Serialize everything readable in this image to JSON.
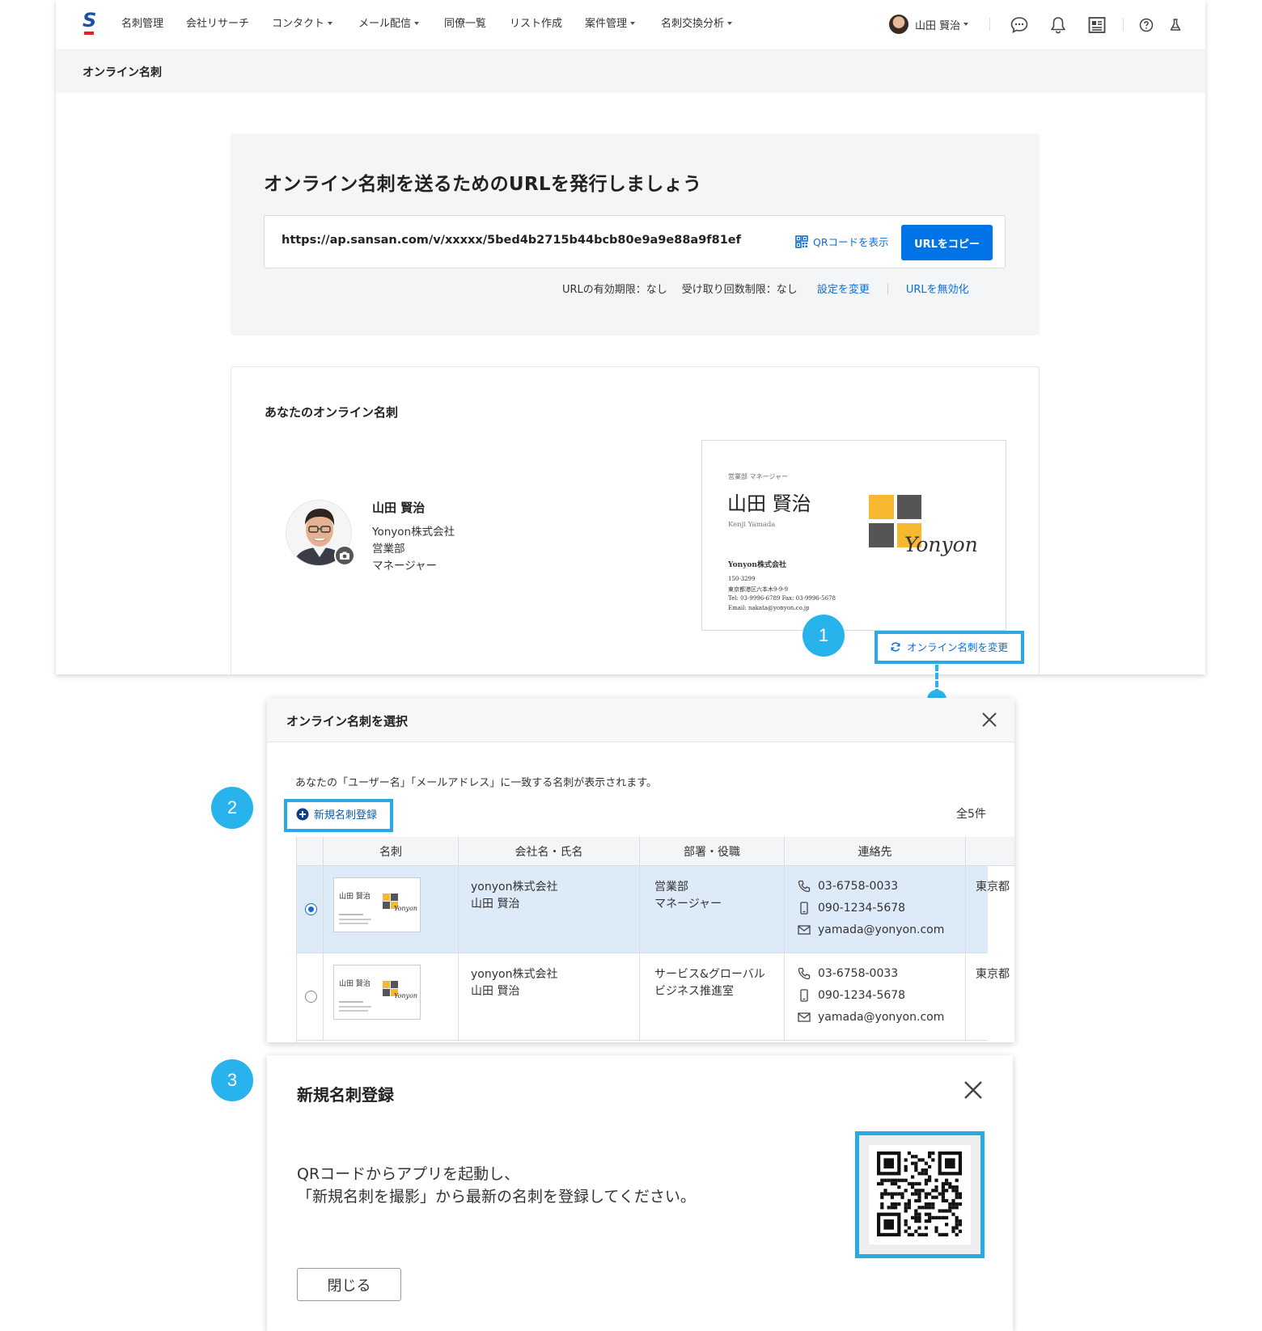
{
  "nav": {
    "items": [
      "名刺管理",
      "会社リサーチ",
      "コンタクト",
      "メール配信",
      "同僚一覧",
      "リスト作成",
      "案件管理",
      "名刺交換分析"
    ],
    "user_name": "山田 賢治"
  },
  "subheader": {
    "title": "オンライン名刺"
  },
  "url_panel": {
    "heading": "オンライン名刺を送るためのURLを発行しましょう",
    "url": "https://ap.sansan.com/v/xxxxx/5bed4b2715b44bcb80e9a9e88a9f81ef",
    "qr_label": "QRコードを表示",
    "copy_label": "URLをコピー",
    "expiry": "URLの有効期限：なし",
    "limit": "受け取り回数制限：なし",
    "change_settings": "設定を変更",
    "disable_url": "URLを無効化"
  },
  "card_panel": {
    "title": "あなたのオンライン名刺",
    "profile": {
      "name": "山田 賢治",
      "company": "Yonyon株式会社",
      "department": "営業部",
      "position": "マネージャー"
    },
    "business_card": {
      "dept_title": "営業部 マネージャー",
      "name": "山田 賢治",
      "romaji": "Kenji Yamada",
      "company": "Yonyon株式会社",
      "postal": "150-3299",
      "address": "東京都港区六本木9-9-9",
      "tel_fax": "Tel: 03-9996-6789   Fax: 03-9996-5678",
      "email": "Email: nakata@yonyon.co.jp",
      "logo_text": "Yonyon"
    },
    "change_link": "オンライン名刺を変更"
  },
  "steps": [
    "1",
    "2",
    "3"
  ],
  "select_modal": {
    "title": "オンライン名刺を選択",
    "description": "あなたの「ユーザー名」「メールアドレス」に一致する名刺が表示されます。",
    "new_button": "新規名刺登録",
    "total": "全5件",
    "columns": [
      "名刺",
      "会社名・氏名",
      "部署・役職",
      "連絡先"
    ],
    "rows": [
      {
        "company": "yonyon株式会社",
        "name": "山田 賢治",
        "dept": "営業部",
        "title": "マネージャー",
        "phone": "03-6758-0033",
        "mobile": "090-1234-5678",
        "email": "yamada@yonyon.com",
        "address": "東京都",
        "selected": true,
        "thumb": {
          "name": "山田 賢治",
          "logo": "Yonyon"
        }
      },
      {
        "company": "yonyon株式会社",
        "name": "山田 賢治",
        "dept": "サービス&グローバル",
        "title": "ビジネス推進室",
        "phone": "03-6758-0033",
        "mobile": "090-1234-5678",
        "email": "yamada@yonyon.com",
        "address": "東京都",
        "selected": false,
        "thumb": {
          "name": "山田 賢治",
          "logo": "Yonyon"
        }
      }
    ]
  },
  "new_modal": {
    "title": "新規名刺登録",
    "line1": "QRコードからアプリを起動し、",
    "line2": "「新規名刺を撮影」から最新の名刺を登録してください。",
    "close_label": "閉じる"
  },
  "colors": {
    "accent": "#0073e6",
    "link": "#0b6ed8",
    "callout": "#29b3ec",
    "logo_yellow": "#f5b82e",
    "logo_gray": "#555555",
    "selected_row": "#ddebf8"
  },
  "icons": [
    "chat-icon",
    "bell-icon",
    "news-icon",
    "help-icon",
    "flask-icon",
    "qr-icon",
    "refresh-icon",
    "plus-circle-icon",
    "close-icon",
    "phone-icon",
    "mobile-icon",
    "mail-icon",
    "camera-icon"
  ]
}
